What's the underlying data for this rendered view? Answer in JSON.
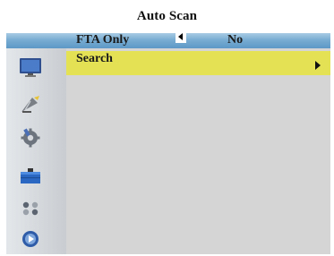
{
  "page": {
    "title": "Auto Scan"
  },
  "menu": {
    "fta_label": "FTA Only",
    "fta_value": "No",
    "search_label": "Search"
  },
  "sidebar": {
    "icons": [
      "tv-icon",
      "satellite-dish-icon",
      "settings-gear-icon",
      "toolbox-icon",
      "network-icon",
      "media-player-icon"
    ]
  },
  "colors": {
    "header_bar": "#6fa6d0",
    "highlight": "#e4e254",
    "panel": "#d5d5d5"
  }
}
